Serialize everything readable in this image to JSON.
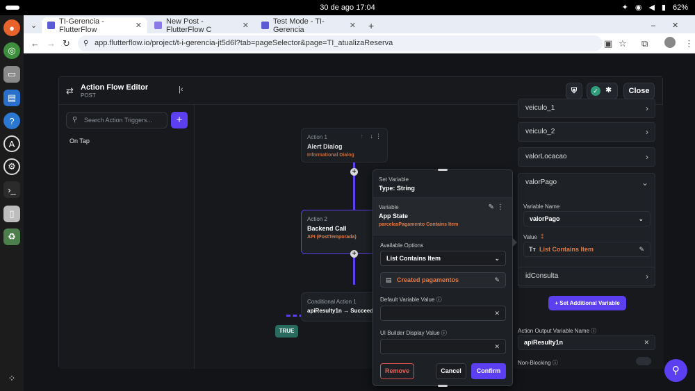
{
  "topbar": {
    "date": "30 de ago  17:04",
    "battery": "62%"
  },
  "browser": {
    "tabs": [
      {
        "label": "TI-Gerencia - FlutterFlow"
      },
      {
        "label": "New Post - FlutterFlow C"
      },
      {
        "label": "Test Mode - TI-Gerencia"
      }
    ],
    "url": "app.flutterflow.io/project/t-i-gerencia-jt5d6l?tab=pageSelector&page=TI_atualizaReserva"
  },
  "editor": {
    "title": "Action Flow Editor",
    "subtitle": "POST",
    "close_label": "Close",
    "search_placeholder": "Search Action Triggers...",
    "trigger": "On Tap"
  },
  "canvas": {
    "action1": {
      "tag": "Action 1",
      "title": "Alert Dialog",
      "sub": "Informational Dialog"
    },
    "action2": {
      "tag": "Action 2",
      "title": "Backend Call",
      "sub": "API (PostTemporada)"
    },
    "cond": {
      "tag": "Conditional Action 1",
      "title": "apiResulty1n → Succeeded"
    },
    "true_label": "TRUE"
  },
  "popup": {
    "set_variable": "Set Variable",
    "type": "Type: String",
    "variable_label": "Variable",
    "variable_value": "App State",
    "variable_sub": "parcelasPagamento Contains Item",
    "available_options": "Available Options",
    "option_value": "List Contains Item",
    "created_value": "Created pagamentos",
    "default_label": "Default Variable Value",
    "ui_label": "UI Builder Display Value",
    "remove": "Remove",
    "cancel": "Cancel",
    "confirm": "Confirm"
  },
  "right_panel": {
    "rows": [
      "veiculo_1",
      "veiculo_2",
      "valorLocacao",
      "valorPago"
    ],
    "variable_name_label": "Variable Name",
    "variable_name_value": "valorPago",
    "value_label": "Value",
    "value_value": "List Contains Item",
    "row_idconsulta": "idConsulta",
    "add_button": "Set Additional Variable",
    "output_label": "Action Output Variable Name",
    "output_value": "apiResulty1n",
    "nonblocking": "Non-Blocking"
  },
  "colors": {
    "accent": "#5b3ff0",
    "orange": "#e07b46",
    "green": "#2f9c7a"
  }
}
